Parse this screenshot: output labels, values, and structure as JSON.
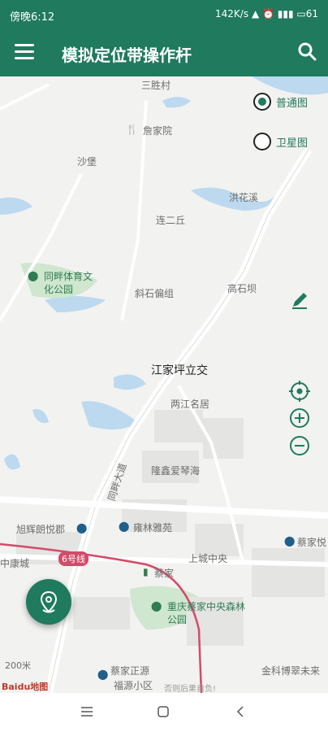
{
  "status_bar": {
    "time": "傍晚6:12",
    "network_speed": "142K/s",
    "battery": "61"
  },
  "app_bar": {
    "title": "模拟定位带操作杆"
  },
  "map_type": {
    "options": [
      {
        "label": "普通图",
        "selected": true
      },
      {
        "label": "卫星图",
        "selected": false
      }
    ]
  },
  "map": {
    "labels": [
      {
        "text": "三胜村",
        "kind": "area"
      },
      {
        "text": "詹家院",
        "kind": "restaurant"
      },
      {
        "text": "沙堡",
        "kind": "area"
      },
      {
        "text": "洪花溪",
        "kind": "area"
      },
      {
        "text": "连二丘",
        "kind": "area"
      },
      {
        "text": "同畔体育文化公园",
        "kind": "park"
      },
      {
        "text": "斜石偏组",
        "kind": "area"
      },
      {
        "text": "高石坝",
        "kind": "area"
      },
      {
        "text": "江家坪立交",
        "kind": "major"
      },
      {
        "text": "两江名居",
        "kind": "area"
      },
      {
        "text": "隆鑫爱琴海",
        "kind": "area"
      },
      {
        "text": "旭辉朗悦郡",
        "kind": "residential"
      },
      {
        "text": "雍林雅苑",
        "kind": "residential"
      },
      {
        "text": "蔡家悦",
        "kind": "residential"
      },
      {
        "text": "上城中央",
        "kind": "area"
      },
      {
        "text": "中康城",
        "kind": "area"
      },
      {
        "text": "蔡家",
        "kind": "metro"
      },
      {
        "text": "重庆蔡家中央森林公园",
        "kind": "park"
      },
      {
        "text": "蔡家正源",
        "kind": "residential"
      },
      {
        "text": "福源小区",
        "kind": "residential"
      },
      {
        "text": "金科博翠未来",
        "kind": "area"
      },
      {
        "text": "同畔大道",
        "kind": "road"
      },
      {
        "text": "6号线",
        "kind": "metro-line"
      }
    ],
    "scale": "200米",
    "attribution": "Baidu地图",
    "footer_note": "否则后果自负!"
  },
  "colors": {
    "primary": "#1f7a5e",
    "metro_line": "#d44a6a"
  },
  "icons": {
    "menu": "menu-icon",
    "search": "search-icon",
    "edit": "pencil-icon",
    "locate": "crosshair-icon",
    "zoom_in": "plus-circle-icon",
    "zoom_out": "minus-circle-icon",
    "fab": "location-pin-icon"
  }
}
